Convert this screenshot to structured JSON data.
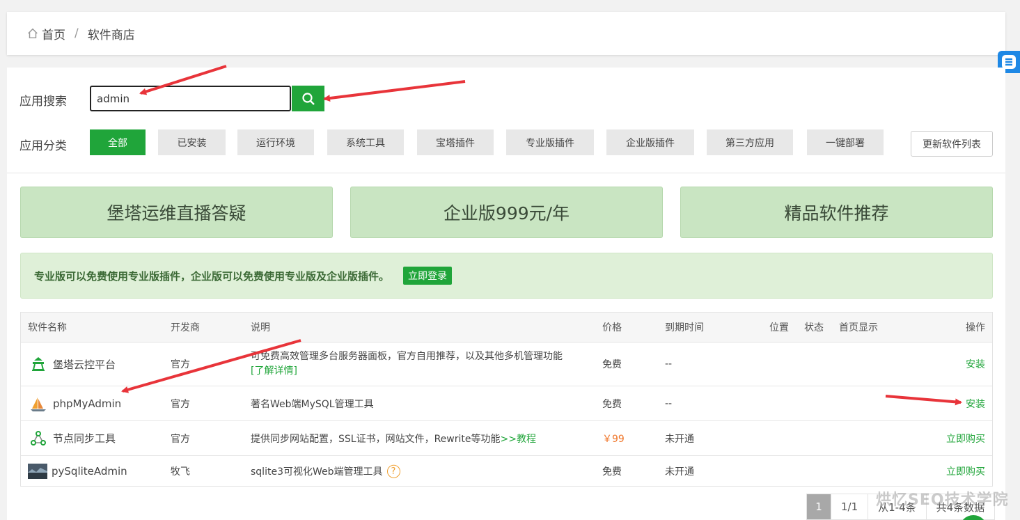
{
  "breadcrumb": {
    "home": "首页",
    "separator": "/",
    "current": "软件商店"
  },
  "search": {
    "label": "应用搜索",
    "value": "admin"
  },
  "categories": {
    "label": "应用分类",
    "items": [
      "全部",
      "已安装",
      "运行环境",
      "系统工具",
      "宝塔插件",
      "专业版插件",
      "企业版插件",
      "第三方应用",
      "一键部署"
    ],
    "active_index": 0,
    "refresh_label": "更新软件列表"
  },
  "banners": [
    "堡塔运维直播答疑",
    "企业版999元/年",
    "精品软件推荐"
  ],
  "notice": {
    "text": "专业版可以免费使用专业版插件，企业版可以免费使用专业版及企业版插件。",
    "login_label": "立即登录"
  },
  "table": {
    "headers": {
      "name": "软件名称",
      "developer": "开发商",
      "desc": "说明",
      "price": "价格",
      "expire": "到期时间",
      "position": "位置",
      "status": "状态",
      "homepage": "首页显示",
      "action": "操作"
    },
    "rows": [
      {
        "name": "堡塔云控平台",
        "developer": "官方",
        "desc": "可免费高效管理多台服务器面板，官方自用推荐，以及其他多机管理功能",
        "desc_link": "[了解详情]",
        "price": "免费",
        "expire": "--",
        "action": "安装",
        "icon": "cloud-control-icon"
      },
      {
        "name": "phpMyAdmin",
        "developer": "官方",
        "desc": "著名Web端MySQL管理工具",
        "price": "免费",
        "expire": "--",
        "action": "安装",
        "icon": "phpmyadmin-sailboat-icon"
      },
      {
        "name": "节点同步工具",
        "developer": "官方",
        "desc": "提供同步网站配置，SSL证书，网站文件，Rewrite等功能",
        "desc_link": ">>教程",
        "price": "￥99",
        "expire": "未开通",
        "action": "立即购买",
        "icon": "node-sync-icon"
      },
      {
        "name": "pySqliteAdmin",
        "developer": "牧飞",
        "desc": "sqlite3可视化Web端管理工具",
        "help": "?",
        "price": "免费",
        "expire": "未开通",
        "action": "立即购买",
        "icon": "pysqliteadmin-thumbnail-icon"
      }
    ]
  },
  "pagination": {
    "current": "1",
    "pages": "1/1",
    "range": "从1-4条",
    "total": "共4条数据"
  },
  "watermark": "烘忆SEO技术学院",
  "colors": {
    "accent": "#20a53a",
    "banner": "#c9e5c2",
    "notice_bg": "#dff0d8",
    "price_paid": "#f0762a",
    "annotation_arrow": "#e8343a"
  }
}
